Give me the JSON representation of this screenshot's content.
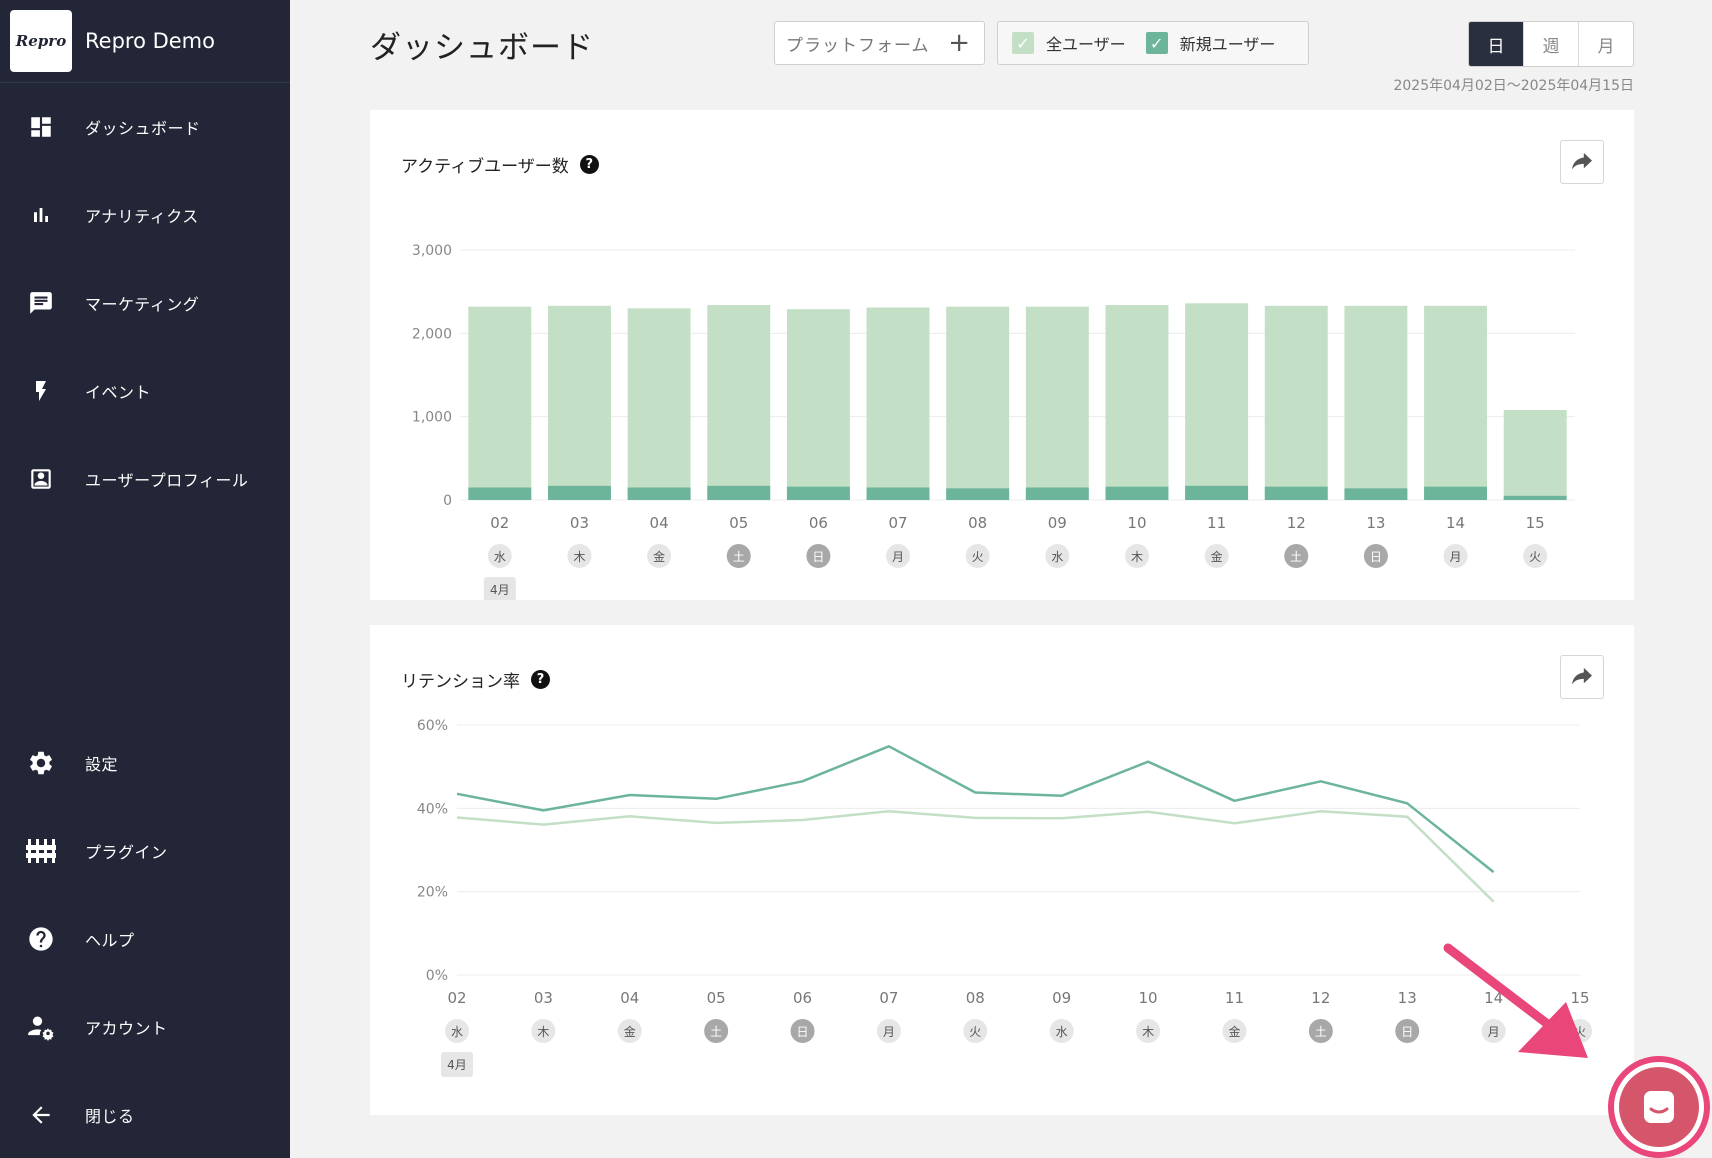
{
  "app": {
    "logo": "Repro",
    "name": "Repro Demo"
  },
  "sidebar": {
    "items": [
      {
        "label": "ダッシュボード",
        "icon": "dashboard-icon"
      },
      {
        "label": "アナリティクス",
        "icon": "bar-chart-icon"
      },
      {
        "label": "マーケティング",
        "icon": "chat-icon"
      },
      {
        "label": "イベント",
        "icon": "bolt-icon"
      },
      {
        "label": "ユーザープロフィール",
        "icon": "profile-icon"
      },
      {
        "label": "設定",
        "icon": "gear-icon"
      },
      {
        "label": "プラグイン",
        "icon": "plugin-icon"
      },
      {
        "label": "ヘルプ",
        "icon": "help-icon"
      },
      {
        "label": "アカウント",
        "icon": "account-settings-icon"
      },
      {
        "label": "閉じる",
        "icon": "arrow-left-icon"
      }
    ]
  },
  "header": {
    "title": "ダッシュボード",
    "platform_label": "プラットフォーム",
    "filters": [
      {
        "label": "全ユーザー",
        "checked": true,
        "color": "#c3dfc5"
      },
      {
        "label": "新規ユーザー",
        "checked": true,
        "color": "#6db59a"
      }
    ],
    "period": {
      "options": [
        "日",
        "週",
        "月"
      ],
      "selected": "日"
    },
    "date_range": "2025年04月02日〜2025年04月15日"
  },
  "colors": {
    "all_users": "#c3dfc5",
    "new_users": "#6db59a",
    "sidebar_bg": "#222636",
    "fab": "#e9467a"
  },
  "cards": {
    "active": {
      "title": "アクティブユーザー数",
      "help": "?"
    },
    "retention": {
      "title": "リテンション率",
      "help": "?"
    }
  },
  "chart_data": [
    {
      "type": "bar",
      "title": "アクティブユーザー数",
      "categories": [
        "02",
        "03",
        "04",
        "05",
        "06",
        "07",
        "08",
        "09",
        "10",
        "11",
        "12",
        "13",
        "14",
        "15"
      ],
      "weekdays": [
        "水",
        "木",
        "金",
        "土",
        "日",
        "月",
        "火",
        "水",
        "木",
        "金",
        "土",
        "日",
        "月",
        "火"
      ],
      "month_label": "4月",
      "series": [
        {
          "values": [
            2320,
            2330,
            2300,
            2340,
            2290,
            2310,
            2320,
            2320,
            2340,
            2360,
            2330,
            2330,
            2330,
            1080
          ]
        },
        {
          "values": [
            150,
            170,
            150,
            170,
            160,
            150,
            140,
            150,
            160,
            170,
            160,
            140,
            160,
            50
          ]
        }
      ],
      "yticks": [
        "0",
        "1,000",
        "2,000",
        "3,000"
      ],
      "ylim": [
        0,
        3000
      ],
      "grid": true
    },
    {
      "type": "line",
      "title": "リテンション率",
      "categories": [
        "02",
        "03",
        "04",
        "05",
        "06",
        "07",
        "08",
        "09",
        "10",
        "11",
        "12",
        "13",
        "14",
        "15"
      ],
      "weekdays": [
        "水",
        "木",
        "金",
        "土",
        "日",
        "月",
        "火",
        "水",
        "木",
        "金",
        "土",
        "日",
        "月",
        "火"
      ],
      "month_label": "4月",
      "series": [
        {
          "values": [
            43.5,
            39.5,
            43.2,
            42.3,
            46.5,
            54.9,
            43.8,
            43.0,
            51.2,
            41.8,
            46.5,
            41.2,
            24.7,
            null
          ]
        },
        {
          "values": [
            37.8,
            36.1,
            38.1,
            36.5,
            37.2,
            39.3,
            37.7,
            37.6,
            39.2,
            36.4,
            39.3,
            38.0,
            17.6,
            null
          ]
        }
      ],
      "yticks": [
        "0%",
        "20%",
        "40%",
        "60%"
      ],
      "ylim": [
        0,
        60
      ],
      "grid": true
    }
  ]
}
